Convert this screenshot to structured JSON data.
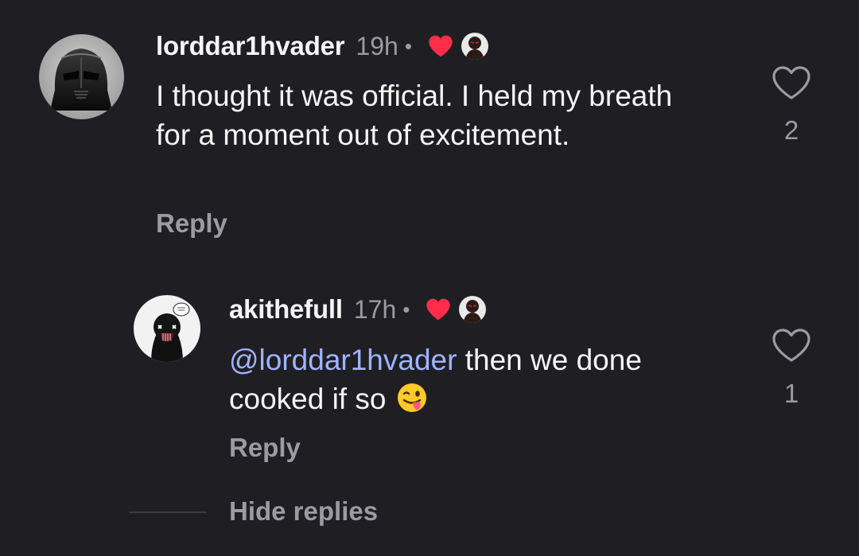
{
  "comments": [
    {
      "username": "lorddar1hvader",
      "time": "19h",
      "separator": "•",
      "text": "I thought it was official. I held my breath for a moment out of excitement.",
      "reply_label": "Reply",
      "like_count": "2",
      "avatar_icon": "darth-vader-avatar"
    },
    {
      "username": "akithefull",
      "time": "17h",
      "separator": "•",
      "mention": "@lorddar1hvader",
      "text": " then we done cooked if so ",
      "emoji": "winking-face-with-tongue-emoji",
      "reply_label": "Reply",
      "like_count": "1",
      "avatar_icon": "masked-character-avatar"
    }
  ],
  "hide_replies_label": "Hide replies",
  "colors": {
    "background": "#1f1f23",
    "heart": "#ff2d4a",
    "mention": "#9fb3ff",
    "muted": "#9b9ba1"
  }
}
